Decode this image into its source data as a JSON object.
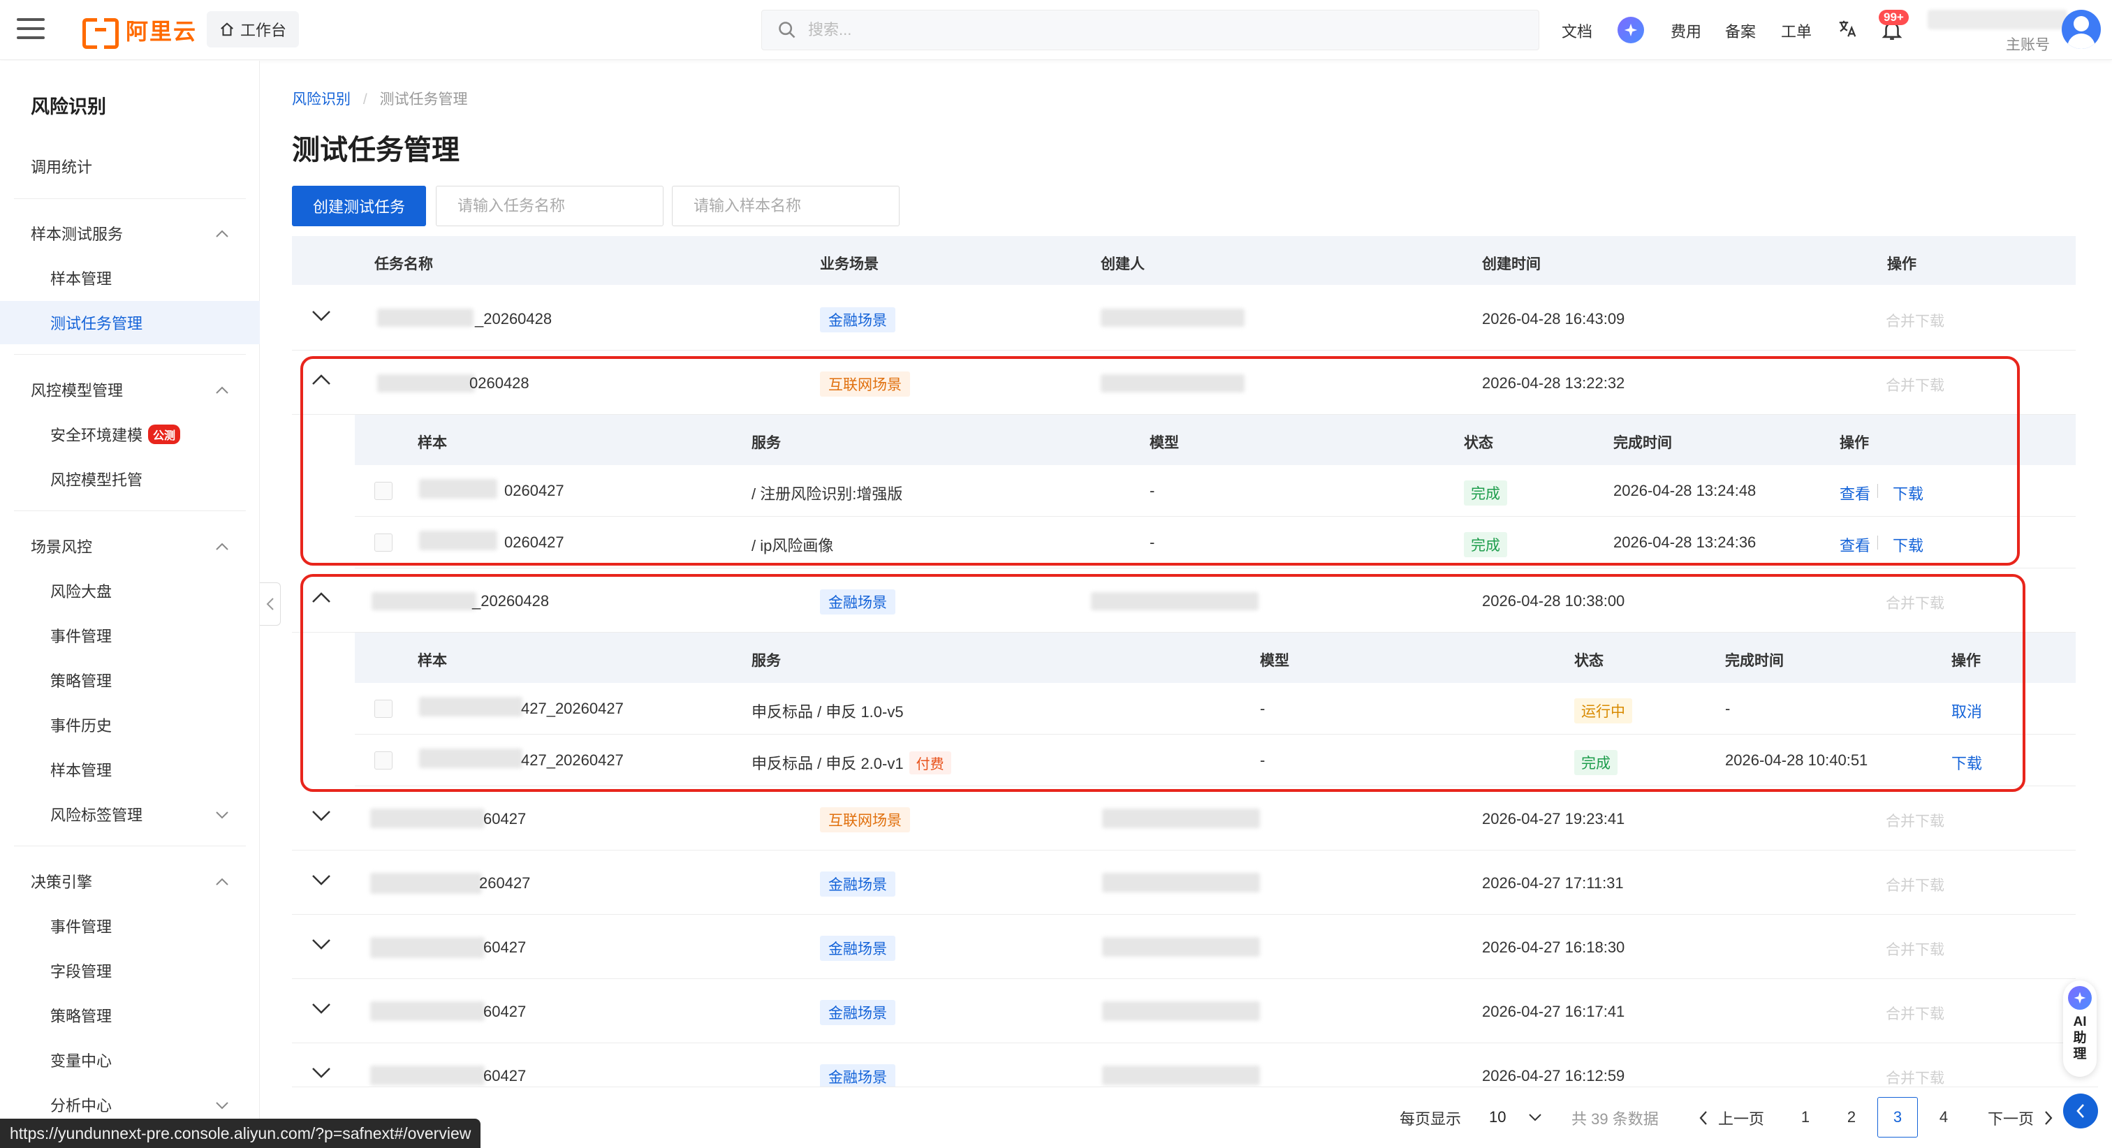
{
  "header": {
    "brand": "阿里云",
    "workbench": "工作台",
    "search_placeholder": "搜索...",
    "links": {
      "docs": "文档",
      "fees": "费用",
      "beian": "备案",
      "ticket": "工单"
    },
    "notif_badge": "99+",
    "account_label": "主账号"
  },
  "sidebar": {
    "title": "风险识别",
    "items": [
      {
        "label": "调用统计"
      },
      {
        "label": "样本测试服务"
      },
      {
        "label": "样本管理"
      },
      {
        "label": "测试任务管理"
      },
      {
        "label": "风控模型管理"
      },
      {
        "label": "安全环境建模",
        "tag": "公测"
      },
      {
        "label": "风控模型托管"
      },
      {
        "label": "场景风控"
      },
      {
        "label": "风险大盘"
      },
      {
        "label": "事件管理"
      },
      {
        "label": "策略管理"
      },
      {
        "label": "事件历史"
      },
      {
        "label": "样本管理"
      },
      {
        "label": "风险标签管理"
      },
      {
        "label": "决策引擎"
      },
      {
        "label": "事件管理"
      },
      {
        "label": "字段管理"
      },
      {
        "label": "策略管理"
      },
      {
        "label": "变量中心"
      },
      {
        "label": "分析中心"
      }
    ]
  },
  "breadcrumb": {
    "root": "风险识别",
    "current": "测试任务管理"
  },
  "page_title": "测试任务管理",
  "toolbar": {
    "create_label": "创建测试任务",
    "task_name_placeholder": "请输入任务名称",
    "sample_name_placeholder": "请输入样本名称"
  },
  "table": {
    "headers": {
      "name": "任务名称",
      "scene": "业务场景",
      "creator": "创建人",
      "created": "创建时间",
      "action": "操作"
    },
    "merge_label": "合并下载",
    "rows": [
      {
        "name": "_20260428",
        "scene": "金融场景",
        "created": "2026-04-28 16:43:09"
      },
      {
        "name": "0260428",
        "scene": "互联网场景",
        "created": "2026-04-28 13:22:32"
      },
      {
        "name": "_20260428",
        "scene": "金融场景",
        "created": "2026-04-28 10:38:00"
      },
      {
        "name": "60427",
        "scene": "互联网场景",
        "created": "2026-04-27 19:23:41"
      },
      {
        "name": "260427",
        "scene": "金融场景",
        "created": "2026-04-27 17:11:31"
      },
      {
        "name": "60427",
        "scene": "金融场景",
        "created": "2026-04-27 16:18:30"
      },
      {
        "name": "60427",
        "scene": "金融场景",
        "created": "2026-04-27 16:17:41"
      },
      {
        "name": "60427",
        "scene": "金融场景",
        "created": "2026-04-27 16:12:59"
      }
    ],
    "sub_headers": {
      "sample": "样本",
      "service": "服务",
      "model": "模型",
      "status": "状态",
      "finished": "完成时间",
      "action": "操作"
    },
    "sub_a": [
      {
        "sample": "0260427",
        "service": "/ 注册风险识别:增强版",
        "model": "-",
        "status": "完成",
        "finished": "2026-04-28 13:24:48",
        "view": "查看",
        "download": "下载"
      },
      {
        "sample": "0260427",
        "service": "/ ip风险画像",
        "model": "-",
        "status": "完成",
        "finished": "2026-04-28 13:24:36",
        "view": "查看",
        "download": "下载"
      }
    ],
    "sub_b": [
      {
        "sample": "427_20260427",
        "service": "申反标品 / 申反 1.0-v5",
        "model": "-",
        "status": "运行中",
        "finished": "-",
        "action": "取消"
      },
      {
        "sample": "427_20260427",
        "service": "申反标品 / 申反 2.0-v1",
        "pay_tag": "付费",
        "model": "-",
        "status": "完成",
        "finished": "2026-04-28 10:40:51",
        "action": "下载"
      }
    ]
  },
  "pagination": {
    "page_size_label": "每页显示",
    "page_size": "10",
    "total": "共 39 条数据",
    "prev": "上一页",
    "next": "下一页",
    "pages": [
      "1",
      "2",
      "3",
      "4"
    ],
    "current": "3"
  },
  "status_url": "https://yundunnext-pre.console.aliyun.com/?p=safnext#/overview",
  "ai_assistant": "AI 助 理"
}
